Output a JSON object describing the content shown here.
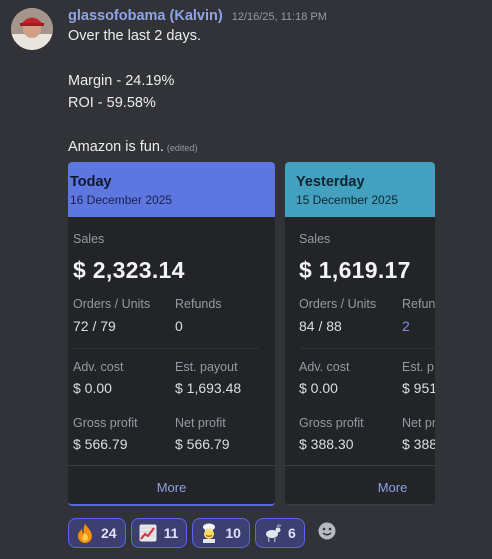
{
  "message": {
    "username": "glassofobama (Kalvin)",
    "timestamp": "12/16/25, 11:18 PM",
    "lines": [
      "Over the last 2 days.",
      "Margin - 24.19%",
      "ROI - 59.58%",
      "Amazon is fun."
    ],
    "edited": "(edited)"
  },
  "cards": [
    {
      "title": "Today",
      "date": "16 December 2025",
      "sales_label": "Sales",
      "sales": "$ 2,323.14",
      "orders_label": "Orders / Units",
      "orders": "72 / 79",
      "refunds_label": "Refunds",
      "refunds": "0",
      "adv_label": "Adv. cost",
      "adv": "$ 0.00",
      "payout_label": "Est. payout",
      "payout": "$ 1,693.48",
      "gross_label": "Gross profit",
      "gross": "$ 566.79",
      "net_label": "Net profit",
      "net": "$ 566.79",
      "more": "More"
    },
    {
      "title": "Yesterday",
      "date": "15 December 2025",
      "sales_label": "Sales",
      "sales": "$ 1,619.17",
      "orders_label": "Orders / Units",
      "orders": "84 / 88",
      "refunds_label": "Refun",
      "refunds": "2",
      "adv_label": "Adv. cost",
      "adv": "$ 0.00",
      "payout_label": "Est. p",
      "payout": "$ 951",
      "gross_label": "Gross profit",
      "gross": "$ 388.30",
      "net_label": "Net pr",
      "net": "$ 388",
      "more": "More"
    }
  ],
  "reactions": [
    {
      "emoji": "fire-icon",
      "count": "24"
    },
    {
      "emoji": "chart-increasing-icon",
      "count": "11"
    },
    {
      "emoji": "cook-icon",
      "count": "10"
    },
    {
      "emoji": "goat-icon",
      "count": "6"
    }
  ],
  "colors": {
    "background": "#313338",
    "username": "#8fa4e8",
    "today_header": "#5e76df",
    "yesterday_header": "#43a1bf",
    "reaction_bg": "#3c3f70",
    "reaction_border": "#5865f2"
  }
}
